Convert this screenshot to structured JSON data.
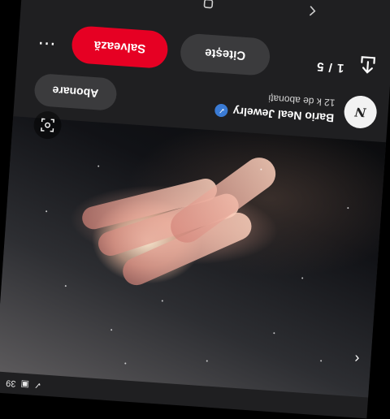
{
  "status_bar": {
    "battery_text": "39",
    "icons": [
      "check-icon",
      "image-icon"
    ]
  },
  "photo": {
    "description_icon": "lens-icon"
  },
  "profile": {
    "avatar_letter": "N",
    "name": "Bario Neal Jewelry",
    "verified_icon": "check-icon",
    "followers": "12 k de abonați",
    "follow_label": "Abonare"
  },
  "actions": {
    "pages": "1 / 5",
    "read_label": "Citește",
    "save_label": "Salvează",
    "share_icon": "share-icon",
    "more_icon": "more-icon"
  },
  "navbar": {
    "items": [
      "back-icon",
      "home-icon",
      "recents-icon"
    ]
  },
  "colors": {
    "save": "#e60023",
    "background": "#1f1f21",
    "pill": "#3b3b3d",
    "verified": "#3a7bd5"
  }
}
